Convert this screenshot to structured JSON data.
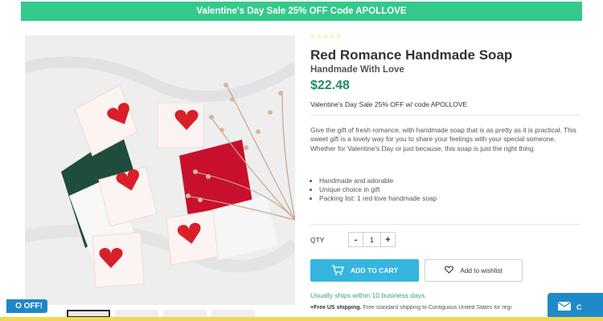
{
  "promo_bar": {
    "text": "Valentine's Day Sale 25% OFF Code APOLLOVE"
  },
  "product": {
    "rating_stars": "☆☆☆☆☆",
    "title": "Red Romance Handmade Soap",
    "subtitle": "Handmade With Love",
    "price": "$22.48",
    "promo_note": "Valentine's Day Sale 25% OFF w/ code APOLLOVE",
    "description": "Give the gift of fresh romance, with handmade soap that is as pretty as it is practical. This sweet gift is a lovely way for you to share your feelings with your special someone. Whether for Valentine's Day or just because, this soap is just the right thing.",
    "features": [
      "Handmade and adorable",
      "Unique choice in gift",
      "Packing list: 1 red love handmade soap"
    ]
  },
  "purchase": {
    "qty_label": "QTY",
    "qty_value": "1",
    "minus_label": "-",
    "plus_label": "+",
    "add_to_cart_label": "ADD TO CART",
    "wishlist_label": "Add to wishlist",
    "ships_text": "Usually ships within 10 business days.",
    "shipping_bold": "+Free US shipping.",
    "shipping_text": " Free standard shipping to Contiguous United States for regi"
  },
  "badge": {
    "text": "O OFF!"
  },
  "contact": {
    "label": "C"
  },
  "colors": {
    "promo": "#34c98a",
    "price": "#1e8f5e",
    "cart": "#35b5e0",
    "badge": "#1e88c7",
    "heart": "#d81f2a"
  },
  "icons": {
    "cart": "cart-icon",
    "wishlist": "heart-outline-icon",
    "contact": "mail-icon"
  }
}
